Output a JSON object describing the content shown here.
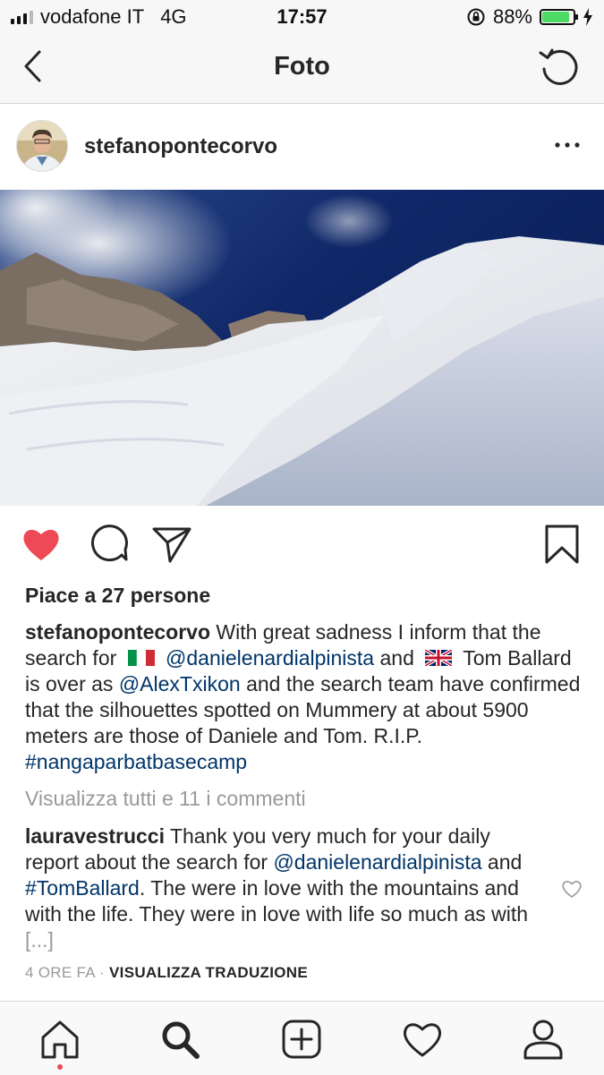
{
  "status_bar": {
    "carrier": "vodafone IT",
    "network": "4G",
    "time": "17:57",
    "battery_percent": "88%",
    "battery_level": 0.88
  },
  "nav": {
    "title": "Foto",
    "back_icon": "chevron-left-icon",
    "refresh_icon": "refresh-icon"
  },
  "post": {
    "username": "stefanopontecorvo",
    "likes_text": "Piace a 27 persone",
    "liked": true,
    "caption": {
      "username": "stefanopontecorvo",
      "part1": "With great sadness I inform that the search for",
      "mention1": "@danielenardialpinista",
      "part2": "and",
      "part3": "Tom Ballard is over as",
      "mention2": "@AlexTxikon",
      "part4": "and the search team have confirmed that the silhouettes spotted on Mummery at about 5900 meters are those of Daniele and Tom. R.I.P.",
      "hashtag": "#nangaparbatbasecamp"
    },
    "view_all_comments": "Visualizza tutti e 11 i commenti",
    "comment": {
      "username": "lauravestrucci",
      "part1": "Thank you very much for your daily report about the search for",
      "mention1": "@danielenardialpinista",
      "part2": "and",
      "hashtag": "#TomBallard",
      "part3": ". The were in love with the mountains and with the life. They were in love with life so much as with",
      "ellipsis": "[...]"
    },
    "time_ago": "4 ORE FA",
    "separator": "·",
    "translate": "VISUALIZZA TRADUZIONE"
  },
  "tab_bar": {
    "items": [
      "home-icon",
      "search-icon",
      "add-post-icon",
      "activity-heart-icon",
      "profile-icon"
    ],
    "active": "home-icon"
  },
  "colors": {
    "like_red": "#ed4956",
    "mention_blue": "#003569",
    "muted_gray": "#999999",
    "text": "#262626"
  }
}
